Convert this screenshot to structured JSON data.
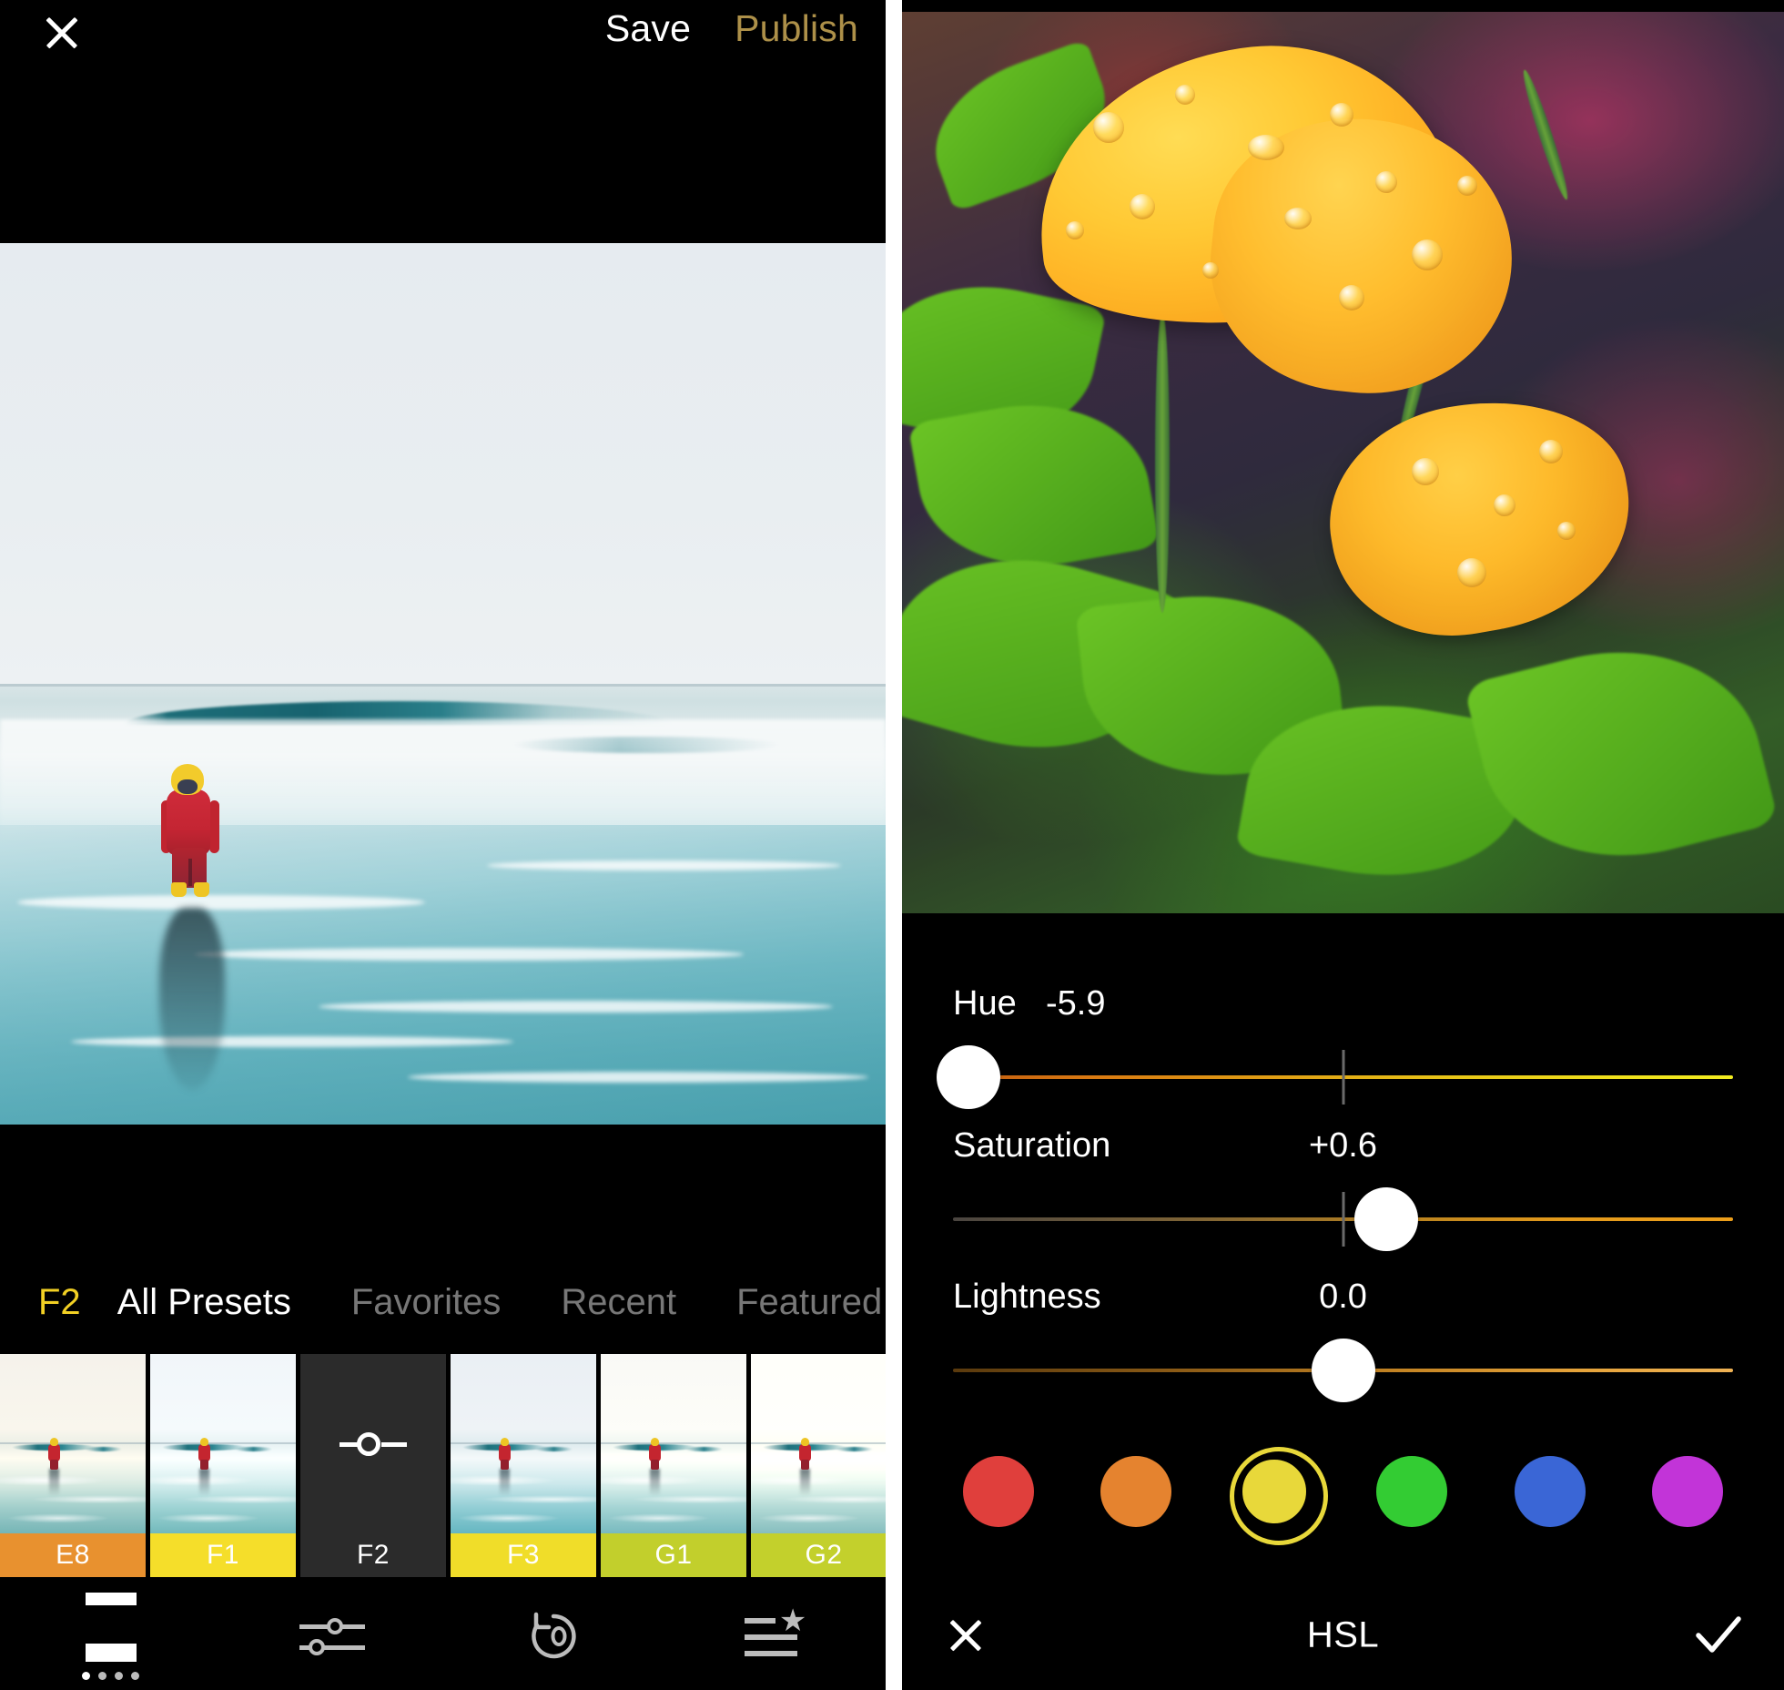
{
  "editor": {
    "topbar": {
      "close_icon": "close-icon",
      "save_label": "Save",
      "publish_label": "Publish",
      "publish_color": "#ad9049"
    },
    "photo": {
      "name": "beach-child-photo",
      "subject": "child in red rain suit on beach"
    },
    "presets": {
      "active_code": "F2",
      "tabs": [
        {
          "label": "All Presets",
          "active": true
        },
        {
          "label": "Favorites",
          "active": false
        },
        {
          "label": "Recent",
          "active": false
        },
        {
          "label": "Featured",
          "active": false
        }
      ],
      "items": [
        {
          "label": "E8",
          "label_bg": "#e8912f",
          "selected": false
        },
        {
          "label": "F1",
          "label_bg": "#f5de2a",
          "selected": false
        },
        {
          "label": "F2",
          "label_bg": "#2b2b2b",
          "selected": true
        },
        {
          "label": "F3",
          "label_bg": "#f0dd29",
          "selected": false
        },
        {
          "label": "G1",
          "label_bg": "#c2cf2c",
          "selected": false
        },
        {
          "label": "G2",
          "label_bg": "#c3d02c",
          "selected": false
        }
      ]
    },
    "toolbar": [
      {
        "icon": "presets-icon",
        "active": true
      },
      {
        "icon": "adjustments-icon",
        "active": false
      },
      {
        "icon": "undo-history-icon",
        "active": false
      },
      {
        "icon": "recipes-star-icon",
        "active": false
      }
    ]
  },
  "hsl": {
    "photo": {
      "name": "yellow-poppy-photo",
      "subject": "yellow poppy flowers with water droplets"
    },
    "sliders": [
      {
        "label": "Hue",
        "value": "-5.9",
        "position_pct": 2,
        "track": "hue"
      },
      {
        "label": "Saturation",
        "value": "+0.6",
        "position_pct": 55.5,
        "track": "saturation"
      },
      {
        "label": "Lightness",
        "value": "0.0",
        "position_pct": 50,
        "track": "lightness"
      }
    ],
    "swatches": [
      {
        "name": "red",
        "color": "#e03f3c",
        "selected": false
      },
      {
        "name": "orange",
        "color": "#e5832f",
        "selected": false
      },
      {
        "name": "yellow",
        "color": "#e8d83a",
        "selected": true
      },
      {
        "name": "green",
        "color": "#33cc33",
        "selected": false
      },
      {
        "name": "blue",
        "color": "#3a66d6",
        "selected": false
      },
      {
        "name": "magenta",
        "color": "#c234d8",
        "selected": false
      }
    ],
    "bottombar": {
      "cancel_icon": "close-icon",
      "title": "HSL",
      "confirm_icon": "checkmark-icon"
    }
  }
}
